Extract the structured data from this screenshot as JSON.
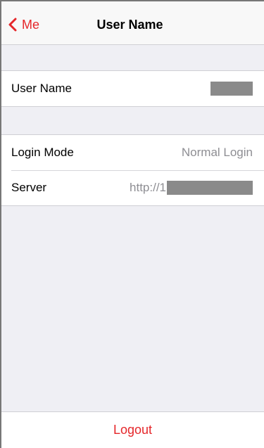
{
  "navbar": {
    "back_label": "Me",
    "title": "User Name",
    "back_icon": "chevron-left-icon"
  },
  "account": {
    "user_name_label": "User Name",
    "user_name_value_redacted": true
  },
  "connection": {
    "login_mode_label": "Login Mode",
    "login_mode_value": "Normal Login",
    "server_label": "Server",
    "server_value_prefix": "http://1",
    "server_value_redacted": true
  },
  "footer": {
    "logout_label": "Logout"
  },
  "colors": {
    "accent": "#e5262a",
    "background": "#efeff4",
    "secondary_text": "#8e8e93",
    "redaction": "#8a8a8a"
  }
}
